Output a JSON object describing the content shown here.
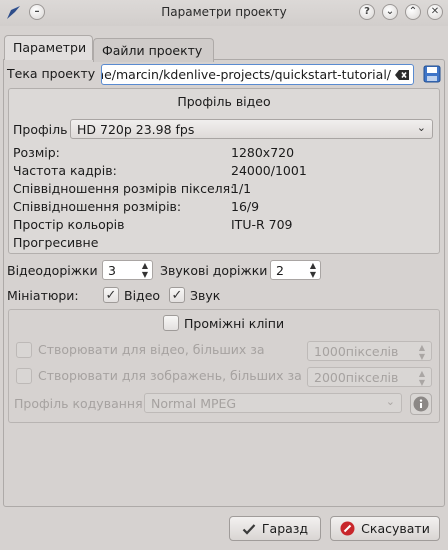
{
  "window": {
    "title": "Параметри проекту"
  },
  "tabs": [
    {
      "label": "Параметри"
    },
    {
      "label": "Файли проекту"
    }
  ],
  "project_folder": {
    "label": "Тека проекту",
    "value": "/home/marcin/kdenlive-projects/quickstart-tutorial/"
  },
  "video_profile": {
    "group_title": "Профіль відео",
    "profile_label": "Профіль",
    "profile_value": "HD 720p 23.98 fps",
    "properties": [
      {
        "label": "Розмір:",
        "value": "1280x720"
      },
      {
        "label": "Частота кадрів:",
        "value": "24000/1001"
      },
      {
        "label": "Співвідношення розмірів пікселя:",
        "value": "1/1"
      },
      {
        "label": "Співвідношення розмірів:",
        "value": "16/9"
      },
      {
        "label": "Простір кольорів",
        "value": "ITU-R 709"
      },
      {
        "label": "Прогресивне",
        "value": ""
      }
    ]
  },
  "tracks": {
    "video_label": "Відеодоріжки",
    "video_value": "3",
    "audio_label": "Звукові доріжки",
    "audio_value": "2"
  },
  "thumbnails": {
    "label": "Мініатюри:",
    "video_label": "Відео",
    "video_checked": true,
    "audio_label": "Звук",
    "audio_checked": true
  },
  "proxy": {
    "label": "Проміжні кліпи",
    "checked": false,
    "video_label": "Створювати для відео, більших за",
    "video_value": "1000пікселів",
    "image_label": "Створювати для зображень, більших за",
    "image_value": "2000пікселів",
    "encoding_label": "Профіль кодування",
    "encoding_value": "Normal MPEG"
  },
  "buttons": {
    "ok": "Гаразд",
    "cancel": "Скасувати"
  },
  "colors": {
    "background": "#d6d2d0",
    "focus_border": "#5a8bd0",
    "cancel_icon": "#c8262b",
    "ok_icon": "#3b3b3b"
  }
}
